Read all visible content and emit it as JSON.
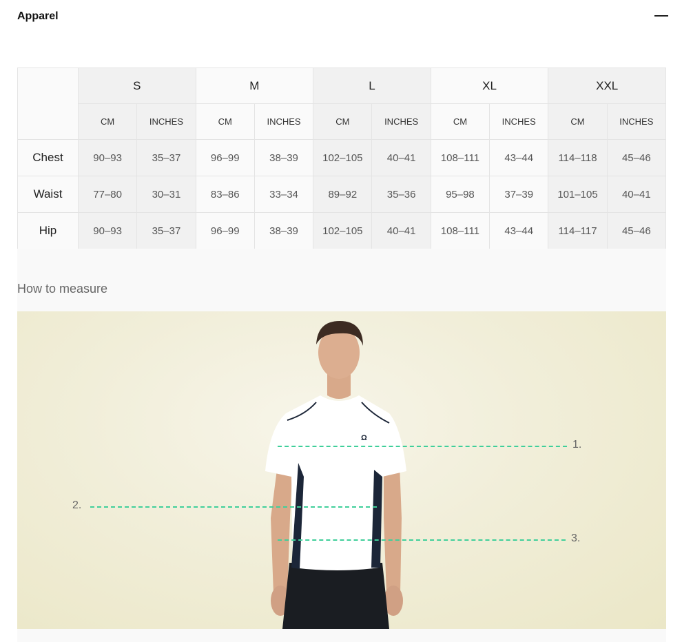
{
  "header": {
    "title": "Apparel"
  },
  "table": {
    "sizes": [
      "S",
      "M",
      "L",
      "XL",
      "XXL"
    ],
    "units": [
      "CM",
      "INCHES",
      "CM",
      "INCHES",
      "CM",
      "INCHES",
      "CM",
      "INCHES",
      "CM",
      "INCHES"
    ],
    "rows": [
      {
        "label": "Chest",
        "values": [
          "90–93",
          "35–37",
          "96–99",
          "38–39",
          "102–105",
          "40–41",
          "108–111",
          "43–44",
          "114–118",
          "45–46"
        ]
      },
      {
        "label": "Waist",
        "values": [
          "77–80",
          "30–31",
          "83–86",
          "33–34",
          "89–92",
          "35–36",
          "95–98",
          "37–39",
          "101–105",
          "40–41"
        ]
      },
      {
        "label": "Hip",
        "values": [
          "90–93",
          "35–37",
          "96–99",
          "38–39",
          "102–105",
          "40–41",
          "108–111",
          "43–44",
          "114–117",
          "45–46"
        ]
      }
    ]
  },
  "measure": {
    "title": "How to measure",
    "labels": [
      "1.",
      "2.",
      "3."
    ]
  },
  "colors": {
    "guide_line": "#3fcf9a",
    "background": "#f1eed9",
    "shirt": "#ffffff",
    "panel": "#1c2638"
  }
}
